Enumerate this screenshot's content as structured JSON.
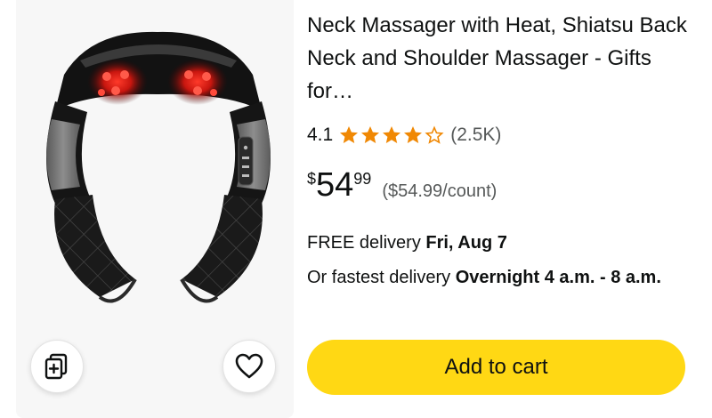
{
  "product": {
    "title": "Neck Massager with Heat, Shiatsu Back Neck and Shoulder Massager - Gifts for…",
    "rating_value": "4.1",
    "rating_stars": 4.1,
    "rating_count": "(2.5K)",
    "price_currency": "$",
    "price_whole": "54",
    "price_fraction": "99",
    "unit_price": "($54.99/count)",
    "image_icon": "neck-massager-image"
  },
  "delivery": {
    "free_prefix": "FREE delivery ",
    "free_date": "Fri, Aug 7",
    "fastest_prefix": "Or fastest delivery ",
    "fastest_window": "Overnight 4 a.m. - 8 a.m."
  },
  "actions": {
    "add_to_cart_label": "Add to cart",
    "compare_icon": "compare-cards-icon",
    "wishlist_icon": "heart-icon"
  },
  "colors": {
    "star": "#f08804",
    "add_to_cart": "#ffd814",
    "secondary_text": "#565959",
    "image_bg": "#f7f7f7"
  }
}
